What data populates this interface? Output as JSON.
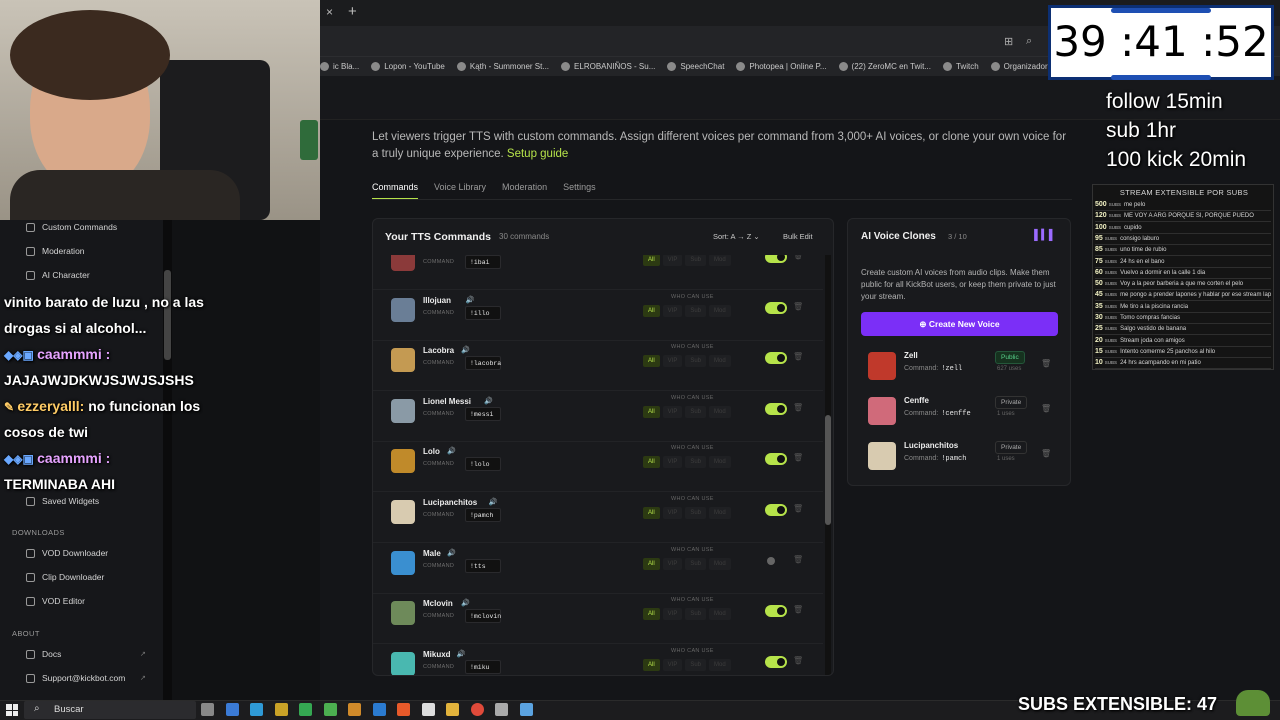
{
  "browser": {
    "close": "×",
    "newtab": "+",
    "bookmarks": [
      "ic Bla...",
      "Lopon - YouTube",
      "Kąth - Summoner St...",
      "ELROBANIÑOS - Su...",
      "SpeechChat",
      "Photopea | Online P...",
      "(22) ZeroMC en Twit...",
      "Twitch",
      "Organizador De Za"
    ]
  },
  "page": {
    "description": "Let viewers trigger TTS with custom commands. Assign different voices per command from 3,000+ AI voices, or clone your own voice for a truly unique experience.",
    "setup_link": "Setup guide",
    "tabs": [
      "Commands",
      "Voice Library",
      "Moderation",
      "Settings"
    ]
  },
  "commands": {
    "title": "Your TTS Commands",
    "count": "30 commands",
    "sort": "Sort: A → Z ⌄",
    "bulk": "Bulk Edit",
    "command_label": "COMMAND",
    "who_label": "WHO CAN USE",
    "pill_labels": [
      "All",
      "VIP",
      "Sub",
      "Mod"
    ],
    "rows": [
      {
        "name": "ibai",
        "cmd": "!ibai",
        "enabled": true,
        "color": "#8b3a3a"
      },
      {
        "name": "Illojuan",
        "cmd": "!illo",
        "enabled": true,
        "color": "#6a7e96"
      },
      {
        "name": "Lacobra",
        "cmd": "!lacobra",
        "enabled": true,
        "color": "#c49a52"
      },
      {
        "name": "Lionel Messi",
        "cmd": "!messi",
        "enabled": true,
        "color": "#8a9aa6"
      },
      {
        "name": "Lolo",
        "cmd": "!lolo",
        "enabled": true,
        "color": "#c08a2a"
      },
      {
        "name": "Lucipanchitos",
        "cmd": "!pamch",
        "enabled": true,
        "color": "#d8cbb0"
      },
      {
        "name": "Male",
        "cmd": "!tts",
        "enabled": false,
        "color": "#3a8fd0"
      },
      {
        "name": "Mclovin",
        "cmd": "!mclovin",
        "enabled": true,
        "color": "#6e8a5a"
      },
      {
        "name": "Mikuxd",
        "cmd": "!miku",
        "enabled": true,
        "color": "#49b8b0"
      }
    ]
  },
  "clones": {
    "title": "AI Voice Clones",
    "count": "3 / 10",
    "desc": "Create custom AI voices from audio clips. Make them public for all KickBot users, or keep them private to just your stream.",
    "button": "Create New Voice",
    "command_label": "Command:",
    "items": [
      {
        "name": "Zell",
        "cmd": "!zell",
        "visibility": "Public",
        "uses": "627 uses",
        "color": "#c0392b"
      },
      {
        "name": "Cenffe",
        "cmd": "!cenffe",
        "visibility": "Private",
        "uses": "1 uses",
        "color": "#d06a7a"
      },
      {
        "name": "Lucipanchitos",
        "cmd": "!pamch",
        "visibility": "Private",
        "uses": "1 uses",
        "color": "#d8cbb0"
      }
    ]
  },
  "sidebar": {
    "top_items": [
      "Custom Commands",
      "Moderation",
      "AI Character"
    ],
    "saved": "Saved Widgets",
    "downloads_header": "DOWNLOADS",
    "downloads": [
      "VOD Downloader",
      "Clip Downloader",
      "VOD Editor"
    ],
    "about_header": "ABOUT",
    "about": [
      "Docs",
      "Support@kickbot.com"
    ]
  },
  "chat": [
    {
      "user": "",
      "text": "vinito barato de luzu , no a las"
    },
    {
      "user": "",
      "text": "drogas si al alcohol..."
    },
    {
      "user": "caammmi :",
      "text": ""
    },
    {
      "user": "",
      "text": "JAJAJWJDKWJSJWJSJSHS"
    },
    {
      "user": "ezzeryalll:",
      "text": " no funcionan los"
    },
    {
      "user": "",
      "text": "cosos de twi"
    },
    {
      "user": "caammmi :",
      "text": ""
    },
    {
      "user": "",
      "text": "TERMINABA AHI"
    }
  ],
  "timer": "39 :41 :52",
  "overlay": {
    "lines": [
      "follow 15min",
      "sub 1hr",
      "100 kick 20min"
    ],
    "subs_header": "STREAM EXTENSIBLE POR SUBS",
    "subs_unit": "SUBS",
    "subs": [
      {
        "n": "500",
        "t": "me pelo"
      },
      {
        "n": "120",
        "t": "ME VOY A ARG PORQUE SI, PORQUE PUEDO"
      },
      {
        "n": "100",
        "t": "cupido"
      },
      {
        "n": "95",
        "t": "consigo laburo"
      },
      {
        "n": "85",
        "t": "uno time de rubio"
      },
      {
        "n": "75",
        "t": "24 hs en el bano"
      },
      {
        "n": "60",
        "t": "Vuelvo a dormir en la calle 1 dia"
      },
      {
        "n": "50",
        "t": "Voy a la peor barberia a que me corten el pelo"
      },
      {
        "n": "45",
        "t": "me pongo a prender lapones y hablar por ese stream lapones"
      },
      {
        "n": "35",
        "t": "Me tiro a la piscina rancia"
      },
      {
        "n": "30",
        "t": "Tomo compras fancias"
      },
      {
        "n": "25",
        "t": "Salgo vestido de banana"
      },
      {
        "n": "20",
        "t": "Stream joda con amigos"
      },
      {
        "n": "15",
        "t": "Intento comerme 25 panchos al hilo"
      },
      {
        "n": "10",
        "t": "24 hrs acampando en mi patio"
      }
    ],
    "subs_extensible": "SUBS EXTENSIBLE: 47"
  },
  "taskbar": {
    "search": "Buscar"
  }
}
